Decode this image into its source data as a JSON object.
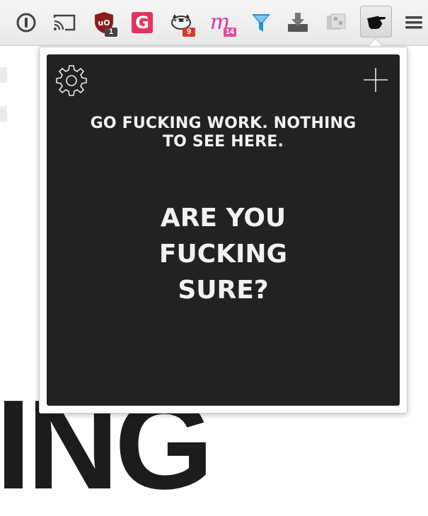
{
  "toolbar": {
    "extensions": [
      {
        "name": "1password-icon"
      },
      {
        "name": "cast-icon"
      },
      {
        "name": "ublock-icon",
        "text": "uO",
        "badge": "1",
        "badge_color": "#444444"
      },
      {
        "name": "grammarly-icon",
        "text": "G",
        "color": "#e3335f"
      },
      {
        "name": "raccoon-icon",
        "badge": "9",
        "badge_color": "#d63a32"
      },
      {
        "name": "mixmax-icon",
        "text": "m",
        "badge": "14",
        "badge_color": "#e04aa0"
      },
      {
        "name": "funnel-icon"
      },
      {
        "name": "download-icon"
      },
      {
        "name": "gallery-icon"
      },
      {
        "name": "hand-pointer-icon"
      },
      {
        "name": "menu-icon"
      }
    ]
  },
  "page": {
    "bg_letters": "ING"
  },
  "popup": {
    "message_line1": "GO FUCKING WORK. NOTHING",
    "message_line2": "TO SEE HERE.",
    "question_line1": "ARE YOU",
    "question_line2": "FUCKING",
    "question_line3": "SURE?",
    "background": "#222222",
    "text_color": "#f2f2f2"
  }
}
